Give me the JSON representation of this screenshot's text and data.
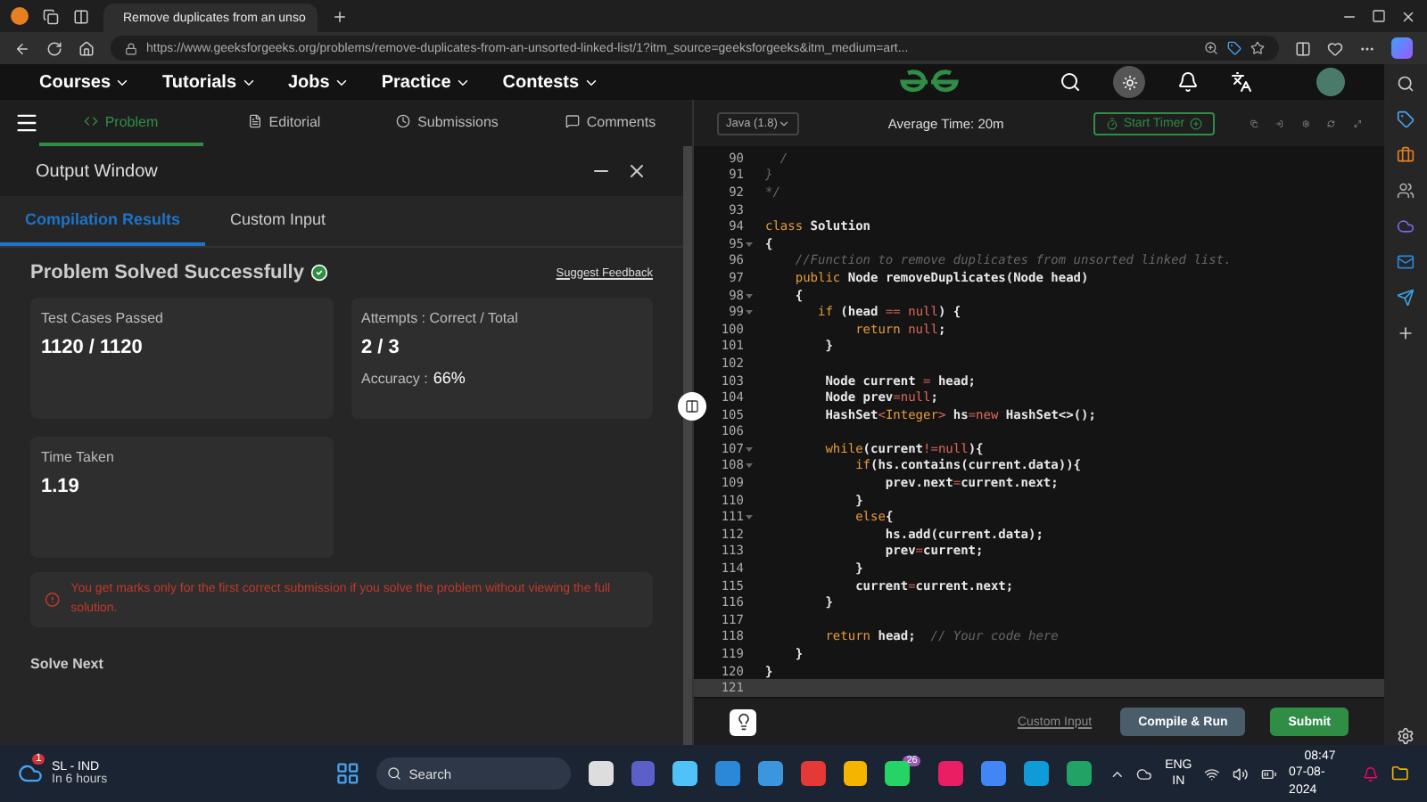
{
  "browser": {
    "tab_title": "Remove duplicates from an unso",
    "url": "https://www.geeksforgeeks.org/problems/remove-duplicates-from-an-unsorted-linked-list/1?itm_source=geeksforgeeks&itm_medium=art..."
  },
  "nav": {
    "items": [
      "Courses",
      "Tutorials",
      "Jobs",
      "Practice",
      "Contests"
    ]
  },
  "problem_tabs": [
    {
      "label": "Problem",
      "selected": true
    },
    {
      "label": "Editorial",
      "selected": false
    },
    {
      "label": "Submissions",
      "selected": false
    },
    {
      "label": "Comments",
      "selected": false
    }
  ],
  "output_window": {
    "title": "Output Window",
    "tabs": [
      {
        "label": "Compilation Results",
        "selected": true
      },
      {
        "label": "Custom Input",
        "selected": false
      }
    ],
    "status": "Problem Solved Successfully",
    "feedback_link": "Suggest Feedback",
    "cards": [
      {
        "label": "Test Cases Passed",
        "value": "1120 / 1120"
      },
      {
        "label": "Attempts : Correct / Total",
        "value": "2 / 3",
        "extra_label": "Accuracy :",
        "extra_value": "66%"
      },
      {
        "label": "Time Taken",
        "value": "1.19"
      }
    ],
    "alert": "You get marks only for the first correct submission if you solve the problem without viewing the full solution.",
    "solve_next": "Solve Next"
  },
  "editor": {
    "language": "Java (1.8)",
    "average_time": "Average Time: 20m",
    "timer_button": "Start Timer",
    "lines": [
      {
        "number": "90",
        "fold": false,
        "active": false,
        "tokens": [
          {
            "kind": "comment",
            "t": "  /"
          }
        ]
      },
      {
        "number": "91",
        "fold": false,
        "active": false,
        "tokens": [
          {
            "kind": "comment",
            "t": "}"
          }
        ]
      },
      {
        "number": "92",
        "fold": false,
        "active": false,
        "tokens": [
          {
            "kind": "comment",
            "t": "*/"
          }
        ]
      },
      {
        "number": "93",
        "fold": false,
        "active": false
      },
      {
        "number": "94",
        "fold": false,
        "active": false,
        "tokens": [
          {
            "kind": "kw",
            "t": "class"
          },
          {
            "kind": "plain",
            "t": " Solution"
          }
        ]
      },
      {
        "number": "95",
        "fold": true,
        "active": false,
        "tokens": [
          {
            "kind": "plain",
            "t": "{"
          }
        ]
      },
      {
        "number": "96",
        "fold": false,
        "active": false,
        "tokens": [
          {
            "kind": "comment",
            "t": "    //Function to remove duplicates from unsorted linked list."
          }
        ]
      },
      {
        "number": "97",
        "fold": false,
        "active": false,
        "tokens": [
          {
            "kind": "kw",
            "t": "    public"
          },
          {
            "kind": "plain",
            "t": " Node removeDuplicates(Node head)"
          }
        ]
      },
      {
        "number": "98",
        "fold": true,
        "active": false,
        "tokens": [
          {
            "kind": "plain",
            "t": "    {"
          }
        ]
      },
      {
        "number": "99",
        "fold": true,
        "active": false,
        "tokens": [
          {
            "kind": "kw",
            "t": "       if"
          },
          {
            "kind": "plain",
            "t": " (head "
          },
          {
            "kind": "op",
            "t": "== "
          },
          {
            "kind": "lit",
            "t": "null"
          },
          {
            "kind": "plain",
            "t": ") {"
          }
        ]
      },
      {
        "number": "100",
        "fold": false,
        "active": false,
        "tokens": [
          {
            "kind": "kw",
            "t": "            return "
          },
          {
            "kind": "lit",
            "t": "null"
          },
          {
            "kind": "plain",
            "t": ";"
          }
        ]
      },
      {
        "number": "101",
        "fold": false,
        "active": false,
        "tokens": [
          {
            "kind": "plain",
            "t": "        }"
          }
        ]
      },
      {
        "number": "102",
        "fold": false,
        "active": false
      },
      {
        "number": "103",
        "fold": false,
        "active": false,
        "tokens": [
          {
            "kind": "plain",
            "t": "        Node current "
          },
          {
            "kind": "op",
            "t": "="
          },
          {
            "kind": "plain",
            "t": " head;"
          }
        ]
      },
      {
        "number": "104",
        "fold": false,
        "active": false,
        "tokens": [
          {
            "kind": "plain",
            "t": "        Node prev"
          },
          {
            "kind": "op",
            "t": "="
          },
          {
            "kind": "lit",
            "t": "null"
          },
          {
            "kind": "plain",
            "t": ";"
          }
        ]
      },
      {
        "number": "105",
        "fold": false,
        "active": false,
        "tokens": [
          {
            "kind": "plain",
            "t": "        HashSet"
          },
          {
            "kind": "op",
            "t": "<"
          },
          {
            "kind": "kw",
            "t": "Integer"
          },
          {
            "kind": "op",
            "t": ">"
          },
          {
            "kind": "plain",
            "t": " hs"
          },
          {
            "kind": "op",
            "t": "="
          },
          {
            "kind": "lit",
            "t": "new"
          },
          {
            "kind": "plain",
            "t": " HashSet<>();"
          }
        ]
      },
      {
        "number": "106",
        "fold": false,
        "active": false
      },
      {
        "number": "107",
        "fold": true,
        "active": false,
        "tokens": [
          {
            "kind": "kw",
            "t": "        while"
          },
          {
            "kind": "plain",
            "t": "(current"
          },
          {
            "kind": "op",
            "t": "!="
          },
          {
            "kind": "lit",
            "t": "null"
          },
          {
            "kind": "plain",
            "t": "){"
          }
        ]
      },
      {
        "number": "108",
        "fold": true,
        "active": false,
        "tokens": [
          {
            "kind": "kw",
            "t": "            if"
          },
          {
            "kind": "plain",
            "t": "(hs.contains(current.data)){"
          }
        ]
      },
      {
        "number": "109",
        "fold": false,
        "active": false,
        "tokens": [
          {
            "kind": "plain",
            "t": "                prev.next"
          },
          {
            "kind": "op",
            "t": "="
          },
          {
            "kind": "plain",
            "t": "current.next;"
          }
        ]
      },
      {
        "number": "110",
        "fold": false,
        "active": false,
        "tokens": [
          {
            "kind": "plain",
            "t": "            }"
          }
        ]
      },
      {
        "number": "111",
        "fold": true,
        "active": false,
        "tokens": [
          {
            "kind": "kw",
            "t": "            else"
          },
          {
            "kind": "plain",
            "t": "{"
          }
        ]
      },
      {
        "number": "112",
        "fold": false,
        "active": false,
        "tokens": [
          {
            "kind": "plain",
            "t": "                hs.add(current.data);"
          }
        ]
      },
      {
        "number": "113",
        "fold": false,
        "active": false,
        "tokens": [
          {
            "kind": "plain",
            "t": "                prev"
          },
          {
            "kind": "op",
            "t": "="
          },
          {
            "kind": "plain",
            "t": "current;"
          }
        ]
      },
      {
        "number": "114",
        "fold": false,
        "active": false,
        "tokens": [
          {
            "kind": "plain",
            "t": "            }"
          }
        ]
      },
      {
        "number": "115",
        "fold": false,
        "active": false,
        "tokens": [
          {
            "kind": "plain",
            "t": "            current"
          },
          {
            "kind": "op",
            "t": "="
          },
          {
            "kind": "plain",
            "t": "current.next;"
          }
        ]
      },
      {
        "number": "116",
        "fold": false,
        "active": false,
        "tokens": [
          {
            "kind": "plain",
            "t": "        }"
          }
        ]
      },
      {
        "number": "117",
        "fold": false,
        "active": false
      },
      {
        "number": "118",
        "fold": false,
        "active": false,
        "tokens": [
          {
            "kind": "kw",
            "t": "        return"
          },
          {
            "kind": "plain",
            "t": " head;  "
          },
          {
            "kind": "comment",
            "t": "// Your code here"
          }
        ]
      },
      {
        "number": "119",
        "fold": false,
        "active": false,
        "tokens": [
          {
            "kind": "plain",
            "t": "    }"
          }
        ]
      },
      {
        "number": "120",
        "fold": false,
        "active": false,
        "tokens": [
          {
            "kind": "plain",
            "t": "}"
          }
        ]
      },
      {
        "number": "121",
        "fold": false,
        "active": true
      }
    ],
    "custom_input_link": "Custom Input",
    "compile_button": "Compile & Run",
    "submit_button": "Submit"
  },
  "taskbar": {
    "weather_badge": "1",
    "weather_title": "SL - IND",
    "weather_subtitle": "In 6 hours",
    "search": "Search",
    "whatsapp_badge": "26",
    "lang_top": "ENG",
    "lang_bottom": "IN",
    "time": "08:47",
    "date": "07-08-2024"
  }
}
